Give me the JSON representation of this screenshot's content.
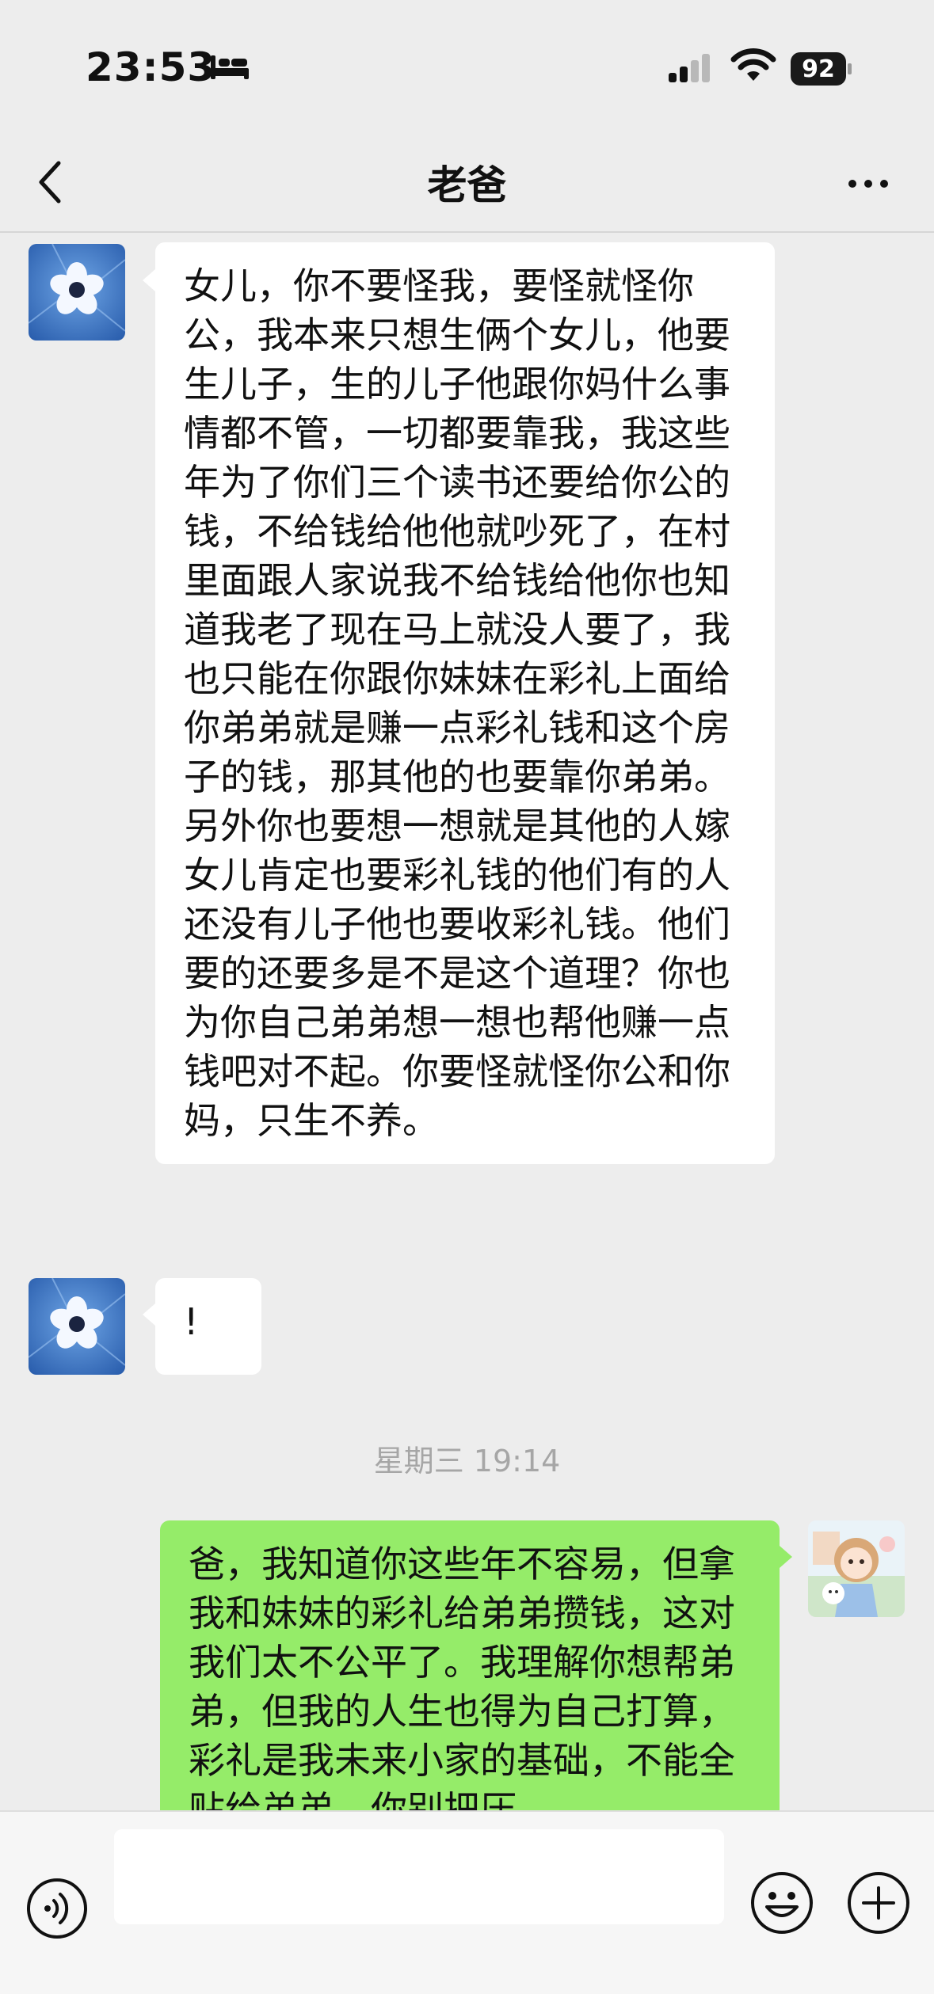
{
  "status_bar": {
    "time": "23:53",
    "battery_level": "92"
  },
  "header": {
    "title": "老爸"
  },
  "messages": [
    {
      "side": "in",
      "text": "女儿，你不要怪我，要怪就怪你公，我本来只想生俩个女儿，他要生儿子，生的儿子他跟你妈什么事情都不管，一切都要靠我，我这些年为了你们三个读书还要给你公的钱，不给钱给他他就吵死了，在村里面跟人家说我不给钱给他你也知道我老了现在马上就没人要了，我也只能在你跟你妹妹在彩礼上面给你弟弟就是赚一点彩礼钱和这个房子的钱，那其他的也要靠你弟弟。另外你也要想一想就是其他的人嫁女儿肯定也要彩礼钱的他们有的人还没有儿子他也要收彩礼钱。他们要的还要多是不是这个道理？你也为你自己弟弟想一想也帮他赚一点钱吧对不起。你要怪就怪你公和你妈，只生不养。"
    },
    {
      "side": "in",
      "text": "!"
    },
    {
      "side": "out",
      "text": "爸，我知道你这些年不容易，但拿我和妹妹的彩礼给弟弟攒钱，这对我们太不公平了。我理解你想帮弟弟，但我的人生也得为自己打算，彩礼是我未来小家的基础，不能全贴给弟弟。你别把压"
    }
  ],
  "timestamp": "星期三 19:14",
  "input": {
    "value": "",
    "placeholder": ""
  },
  "colors": {
    "background": "#ededed",
    "incoming_bubble": "#ffffff",
    "outgoing_bubble": "#95ec69",
    "timestamp_text": "#a6a6a6"
  },
  "icons": [
    "bed-icon",
    "signal-icon",
    "wifi-icon",
    "back-arrow-icon",
    "more-icon",
    "flower-avatar",
    "anime-girl-avatar",
    "voice-icon",
    "emoji-icon",
    "plus-icon"
  ]
}
